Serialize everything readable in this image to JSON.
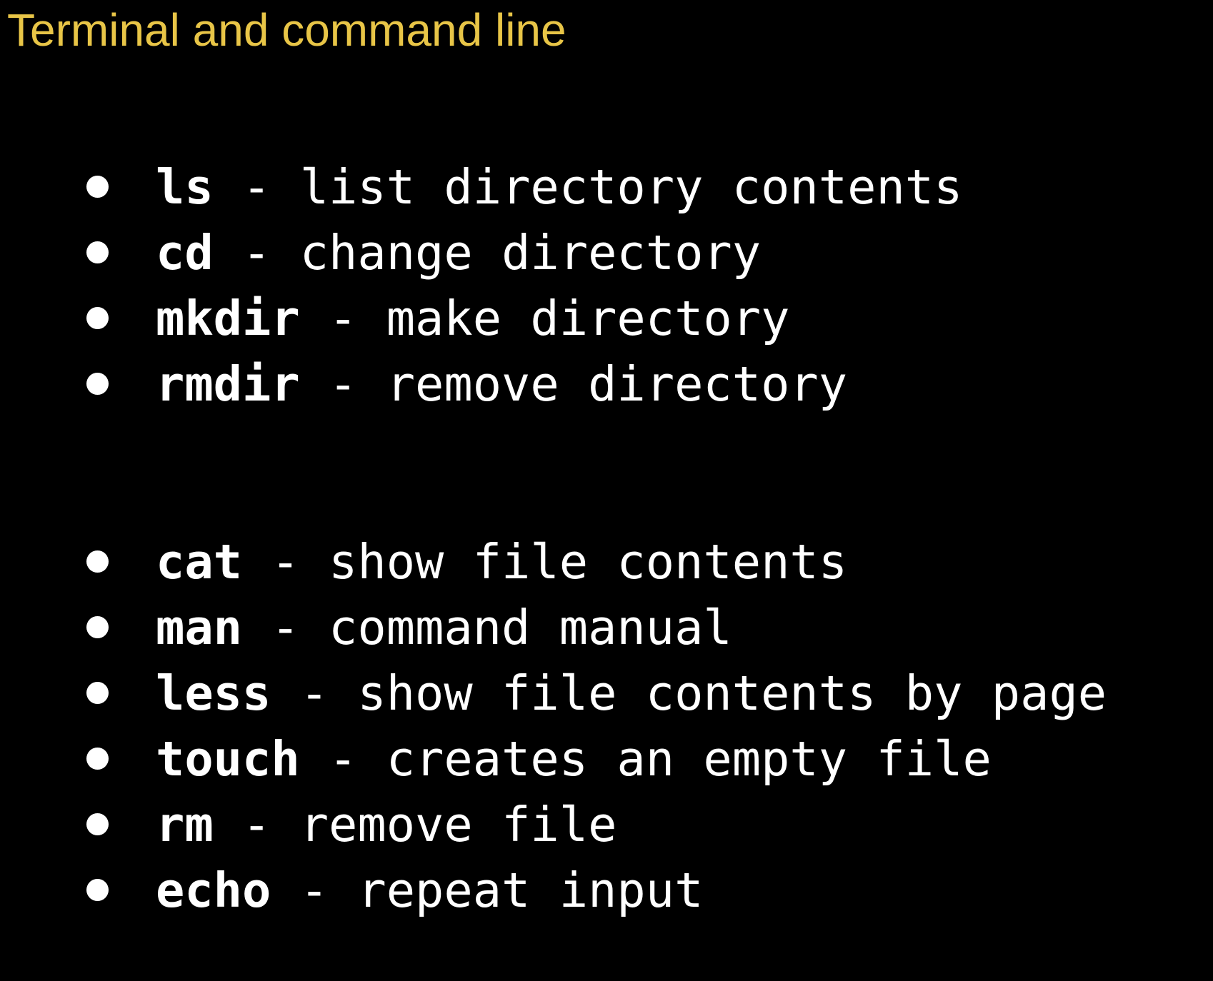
{
  "slide": {
    "title": "Terminal and command line",
    "title_color": "#E8C547",
    "background_color": "#000000",
    "text_color": "#FFFFFF",
    "separator": " - ",
    "groups": [
      {
        "items": [
          {
            "command": "ls",
            "description": "list directory contents"
          },
          {
            "command": "cd",
            "description": "change directory"
          },
          {
            "command": "mkdir",
            "description": "make directory"
          },
          {
            "command": "rmdir",
            "description": "remove directory"
          }
        ]
      },
      {
        "items": [
          {
            "command": "cat",
            "description": "show file contents"
          },
          {
            "command": "man",
            "description": "command manual"
          },
          {
            "command": "less",
            "description": "show file contents by page"
          },
          {
            "command": "touch",
            "description": "creates an empty file"
          },
          {
            "command": "rm",
            "description": "remove file"
          },
          {
            "command": "echo",
            "description": "repeat input"
          }
        ]
      }
    ]
  }
}
